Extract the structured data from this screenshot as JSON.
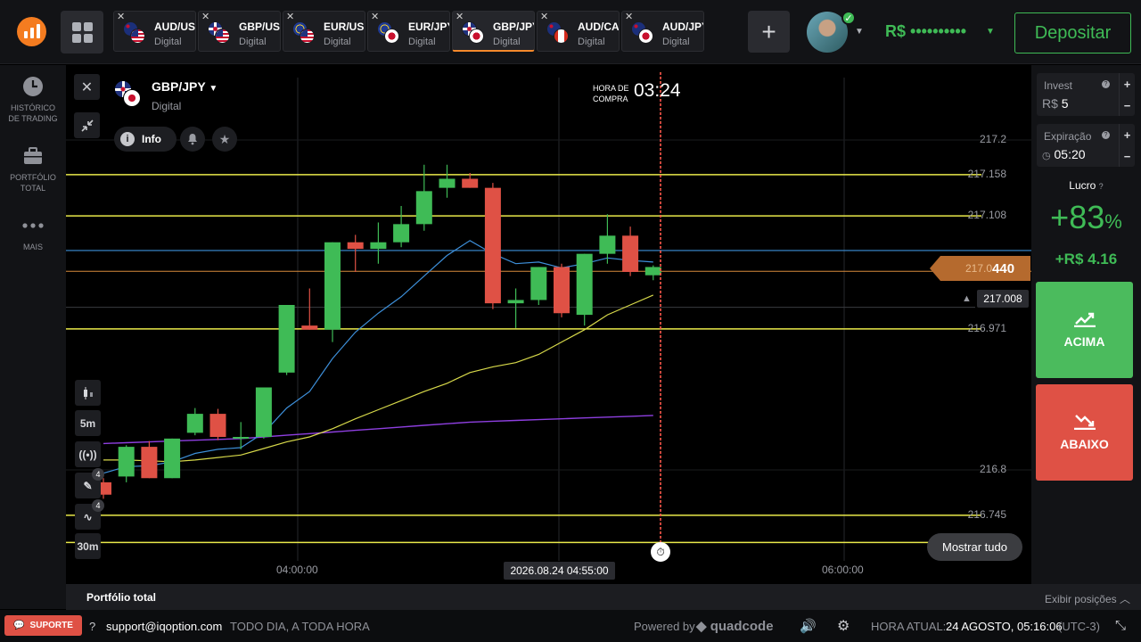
{
  "topbar": {
    "tabs": [
      {
        "name": "AUD/USD",
        "sub": "Digital",
        "flag1": "au",
        "flag2": "us"
      },
      {
        "name": "GBP/USD",
        "sub": "Digital",
        "flag1": "uk",
        "flag2": "us"
      },
      {
        "name": "EUR/USD",
        "sub": "Digital",
        "flag1": "eu",
        "flag2": "us"
      },
      {
        "name": "EUR/JPY",
        "sub": "Digital",
        "flag1": "eu",
        "flag2": "jp"
      },
      {
        "name": "GBP/JPY",
        "sub": "Digital",
        "flag1": "uk",
        "flag2": "jp",
        "active": true
      },
      {
        "name": "AUD/CAD",
        "sub": "Digital",
        "flag1": "au",
        "flag2": "ca"
      },
      {
        "name": "AUD/JPY",
        "sub": "Digital",
        "flag1": "au",
        "flag2": "jp"
      }
    ],
    "tab_close": "✕",
    "add_tab": "+",
    "balance": "R$ ••••••••••",
    "deposit": "Depositar"
  },
  "sidebar": {
    "items": [
      {
        "label1": "HISTÓRICO",
        "label2": "DE TRADING",
        "icon": "clock-icon"
      },
      {
        "label1": "PORTFÓLIO",
        "label2": "TOTAL",
        "icon": "briefcase-icon"
      },
      {
        "label1": "MAIS",
        "label2": "",
        "icon": "more-icon"
      }
    ]
  },
  "chart": {
    "asset": "GBP/JPY",
    "asset_type": "Digital",
    "info": "Info",
    "purchase_label_1": "HORA DE",
    "purchase_label_2": "COMPRA",
    "purchase_time": "03:24",
    "current_price_prefix": "217.0",
    "current_price_suffix": "440",
    "alert_price": "217.008",
    "timeframe": "5m",
    "chart_interval": "30m",
    "draw_badge": "4",
    "indicator_badge": "4",
    "cursor_time": "2026.08.24 04:55:00",
    "show_all": "Mostrar tudo"
  },
  "chart_data": {
    "type": "candlestick",
    "price_labels": [
      "217.2",
      "217.158",
      "217.108",
      "216.971",
      "216.8",
      "216.745"
    ],
    "x_labels": [
      "04:00:00",
      "06:00:00"
    ],
    "level_lines": [
      217.158,
      217.108,
      216.971,
      216.745,
      216.712
    ],
    "candles": [
      {
        "o": 216.785,
        "h": 216.79,
        "l": 216.765,
        "c": 216.77
      },
      {
        "o": 216.792,
        "h": 216.83,
        "l": 216.785,
        "c": 216.828
      },
      {
        "o": 216.828,
        "h": 216.835,
        "l": 216.79,
        "c": 216.79
      },
      {
        "o": 216.79,
        "h": 216.838,
        "l": 216.79,
        "c": 216.838
      },
      {
        "o": 216.845,
        "h": 216.875,
        "l": 216.842,
        "c": 216.868
      },
      {
        "o": 216.868,
        "h": 216.874,
        "l": 216.836,
        "c": 216.84
      },
      {
        "o": 216.84,
        "h": 216.858,
        "l": 216.825,
        "c": 216.84
      },
      {
        "o": 216.84,
        "h": 216.9,
        "l": 216.838,
        "c": 216.9
      },
      {
        "o": 216.918,
        "h": 217.0,
        "l": 216.915,
        "c": 217.0
      },
      {
        "o": 216.975,
        "h": 217.02,
        "l": 216.97,
        "c": 216.97
      },
      {
        "o": 216.97,
        "h": 217.076,
        "l": 216.955,
        "c": 217.076
      },
      {
        "o": 217.076,
        "h": 217.085,
        "l": 217.04,
        "c": 217.068
      },
      {
        "o": 217.068,
        "h": 217.1,
        "l": 217.05,
        "c": 217.076
      },
      {
        "o": 217.076,
        "h": 217.12,
        "l": 217.07,
        "c": 217.098
      },
      {
        "o": 217.098,
        "h": 217.17,
        "l": 217.09,
        "c": 217.138
      },
      {
        "o": 217.142,
        "h": 217.17,
        "l": 217.13,
        "c": 217.153
      },
      {
        "o": 217.153,
        "h": 217.16,
        "l": 217.142,
        "c": 217.142
      },
      {
        "o": 217.142,
        "h": 217.148,
        "l": 216.995,
        "c": 217.002
      },
      {
        "o": 217.002,
        "h": 217.02,
        "l": 216.972,
        "c": 217.006
      },
      {
        "o": 217.006,
        "h": 217.046,
        "l": 217.0,
        "c": 217.046
      },
      {
        "o": 217.046,
        "h": 217.05,
        "l": 216.985,
        "c": 216.99
      },
      {
        "o": 216.988,
        "h": 217.062,
        "l": 216.975,
        "c": 217.062
      },
      {
        "o": 217.062,
        "h": 217.11,
        "l": 217.05,
        "c": 217.084
      },
      {
        "o": 217.084,
        "h": 217.095,
        "l": 217.035,
        "c": 217.04
      },
      {
        "o": 217.036,
        "h": 217.048,
        "l": 217.03,
        "c": 217.046
      }
    ],
    "ma_fast": [
      216.796,
      216.804,
      216.805,
      216.81,
      216.82,
      216.825,
      216.827,
      216.845,
      216.875,
      216.895,
      216.935,
      216.967,
      216.99,
      217.01,
      217.035,
      217.06,
      217.078,
      217.062,
      217.05,
      217.052,
      217.045,
      217.05,
      217.057,
      217.054,
      217.052
    ],
    "ma_slow": [
      216.812,
      216.812,
      216.811,
      216.81,
      216.812,
      216.815,
      216.818,
      216.826,
      216.834,
      216.84,
      216.85,
      216.862,
      216.873,
      216.884,
      216.895,
      216.905,
      216.918,
      216.925,
      216.93,
      216.94,
      216.955,
      216.97,
      216.988,
      217.0,
      217.012
    ],
    "ma_long": [
      216.832,
      216.833,
      216.834,
      216.835,
      216.836,
      216.837,
      216.838,
      216.84,
      216.842,
      216.844,
      216.846,
      216.848,
      216.85,
      216.852,
      216.854,
      216.856,
      216.858,
      216.859,
      216.86,
      216.861,
      216.862,
      216.863,
      216.864,
      216.865,
      216.866
    ],
    "blue_level": 217.066,
    "orange_level": 217.044,
    "current_price": 217.044,
    "alert_level": 217.008
  },
  "panel": {
    "invest_label": "Invest",
    "invest_currency": "R$",
    "invest_value": "5",
    "expiry_label": "Expiração",
    "expiry_value": "05:20",
    "profit_label": "Lucro",
    "profit_pct": "+83",
    "profit_pct_sign": "%",
    "profit_value": "+R$ 4.16",
    "up_label": "ACIMA",
    "down_label": "ABAIXO"
  },
  "bottom": {
    "portfolio": "Portfólio total",
    "positions": "Exibir posições"
  },
  "footer": {
    "support": "SUPORTE",
    "email": "support@iqoption.com",
    "hours": "TODO DIA, A TODA HORA",
    "powered": "Powered by",
    "brand": "quadcode",
    "time_label": "HORA ATUAL:",
    "time_value": "24 AGOSTO, 05:16:06",
    "timezone": "(UTC-3)"
  },
  "colors": {
    "accent_green": "#3fbb56",
    "accent_red": "#df5145",
    "level_yellow": "#e9e94a",
    "ma_blue": "#3d8fd9",
    "ma_purple": "#8e3fe0"
  }
}
